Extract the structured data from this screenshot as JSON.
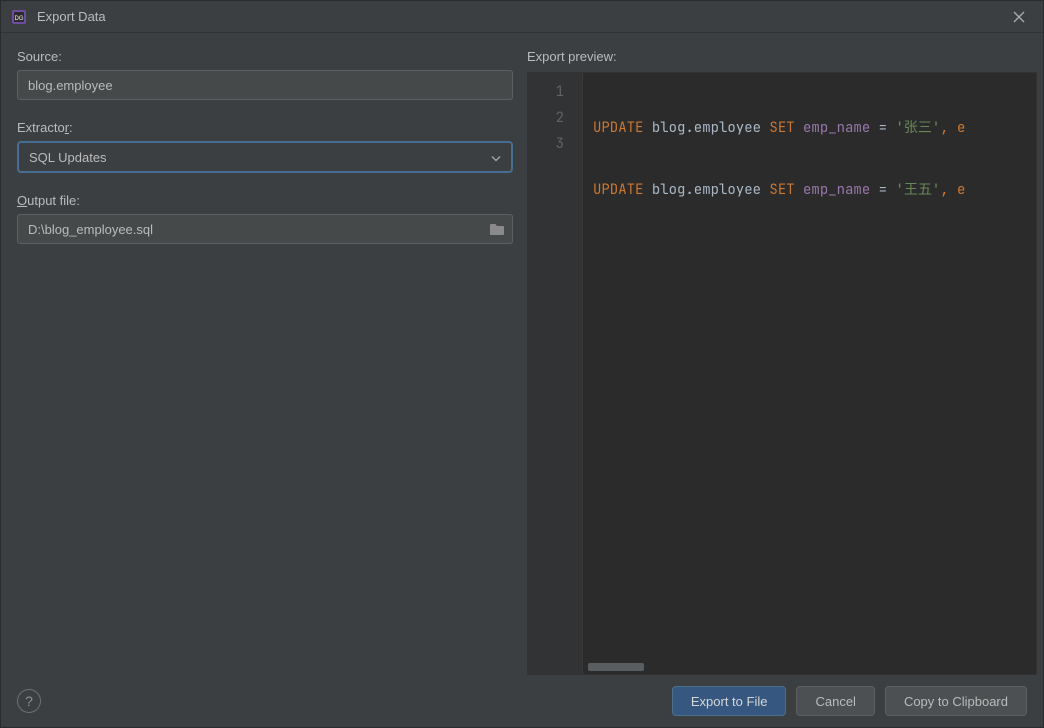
{
  "window": {
    "title": "Export Data"
  },
  "labels": {
    "source": "Source:",
    "extractor_pre": "Extracto",
    "extractor_mn": "r",
    "extractor_post": ":",
    "output_mn": "O",
    "output_post": "utput file:",
    "preview": "Export preview:"
  },
  "source": {
    "value": "blog.employee"
  },
  "extractor": {
    "value": "SQL Updates"
  },
  "output": {
    "value": "D:\\blog_employee.sql"
  },
  "preview": {
    "gutter": [
      "1",
      "2",
      "3"
    ],
    "lines": [
      {
        "kw1": "UPDATE",
        "tbl": "blog.employee",
        "kw2": "SET",
        "fld": "emp_name",
        "eq": " = ",
        "q1": "'",
        "str": "张三",
        "q2": "'",
        "tail": ", e"
      },
      {
        "kw1": "UPDATE",
        "tbl": "blog.employee",
        "kw2": "SET",
        "fld": "emp_name",
        "eq": " = ",
        "q1": "'",
        "str": "王五",
        "q2": "'",
        "tail": ", e"
      }
    ]
  },
  "buttons": {
    "export": "Export to File",
    "cancel": "Cancel",
    "copy": "Copy to Clipboard"
  }
}
